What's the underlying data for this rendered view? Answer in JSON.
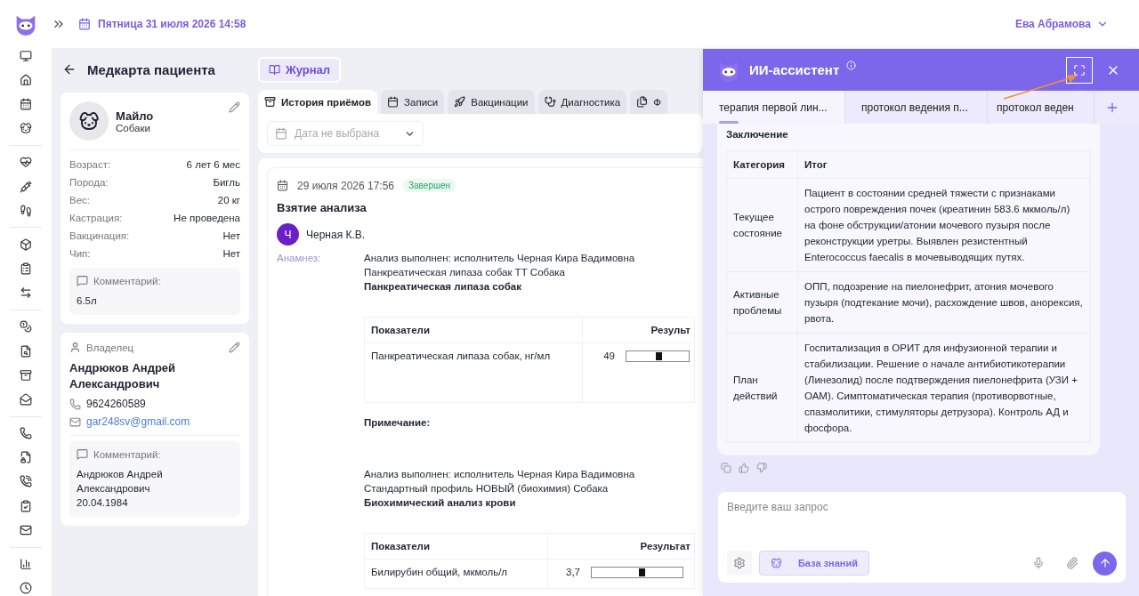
{
  "top_bar": {
    "date": "Пятница 31 июля 2026 14:58",
    "user": "Ева Абрамова"
  },
  "page": {
    "title": "Медкарта пациента",
    "journal_button": "Журнал"
  },
  "patient": {
    "name": "Майло",
    "species": "Собаки",
    "fields": [
      {
        "label": "Возраст:",
        "value": "6 лет 6 мес"
      },
      {
        "label": "Порода:",
        "value": "Бигль"
      },
      {
        "label": "Вес:",
        "value": "20 кг"
      },
      {
        "label": "Кастрация:",
        "value": "Не проведена"
      },
      {
        "label": "Вакцинация:",
        "value": "Нет"
      },
      {
        "label": "Чип:",
        "value": "Нет"
      }
    ],
    "comment_label": "Комментарий:",
    "comment": "6.5л"
  },
  "owner": {
    "label": "Владелец",
    "name": "Андрюков Андрей Александрович",
    "phone": "9624260589",
    "email": "gar248sv@gmail.com",
    "comment_label": "Комментарий:",
    "comment": "Андрюков Андрей Александрович 20.04.1984"
  },
  "tabs": [
    {
      "label": "История приёмов",
      "selected": true
    },
    {
      "label": "Записи",
      "selected": false
    },
    {
      "label": "Вакцинации",
      "selected": false
    },
    {
      "label": "Диагностика",
      "selected": false
    },
    {
      "label": "Ф",
      "selected": false
    }
  ],
  "date_filter": {
    "placeholder": "Дата не выбрана"
  },
  "visit": {
    "date": "29 июля 2026 17:56",
    "status": "Завершен",
    "title": "Взятие анализа",
    "doctor_initial": "Ч",
    "doctor": "Черная К.В.",
    "anamnesis_label": "Анамнез:",
    "blocks": [
      {
        "lines": [
          "Анализ выполнен: исполнитель Черная Кира Вадимовна",
          "Панкреатическая липаза собак ТТ Собака"
        ],
        "heading": "Панкреатическая липаза собак",
        "columns": [
          "Показатели",
          "Результ"
        ],
        "rows": [
          {
            "name": "Панкреатическая липаза собак, нг/мл",
            "value": "49",
            "level": 0.52
          }
        ],
        "note_label": "Примечание:"
      },
      {
        "lines": [
          "Анализ выполнен: исполнитель Черная Кира Вадимовна",
          "Стандартный профиль НОВЫЙ (биохимия) Собака"
        ],
        "heading": "Биохимический анализ крови",
        "columns": [
          "Показатели",
          "Результат"
        ],
        "rows": [
          {
            "name": "Билирубин общий, мкмоль/л",
            "value": "3,7",
            "level": 0.55
          }
        ]
      }
    ]
  },
  "assistant": {
    "title": "ИИ-ассистент",
    "tabs": [
      {
        "label": "терапия первой лин...",
        "selected": true
      },
      {
        "label": "протокол ведения п...",
        "selected": false
      },
      {
        "label": "протокол веден",
        "selected": false
      }
    ],
    "conclusion_title": "Заключение",
    "columns": [
      "Категория",
      "Итог"
    ],
    "rows": [
      {
        "category": "Текущее состояние",
        "result": "Пациент в состоянии средней тяжести с признаками острого повреждения почек (креатинин 583.6 мкмоль/л) на фоне обструкции/атонии мочевого пузыря после реконструкции уретры. Выявлен резистентный Enterococcus faecalis в мочевыводящих путях."
      },
      {
        "category": "Активные проблемы",
        "result": "ОПП, подозрение на пиелонефрит, атония мочевого пузыря (подтекание мочи), расхождение швов, анорексия, рвота."
      },
      {
        "category": "План действий",
        "result": "Госпитализация в ОРИТ для инфузионной терапии и стабилизации. Решение о начале антибиотикотерапии (Линезолид) после подтверждения пиелонефрита (УЗИ + ОАМ). Симптоматическая терапия (противорвотные, спазмолитики, стимуляторы детрузора). Контроль АД и фосфора."
      }
    ],
    "input_placeholder": "Введите ваш запрос",
    "knowledge_button": "База знаний"
  }
}
